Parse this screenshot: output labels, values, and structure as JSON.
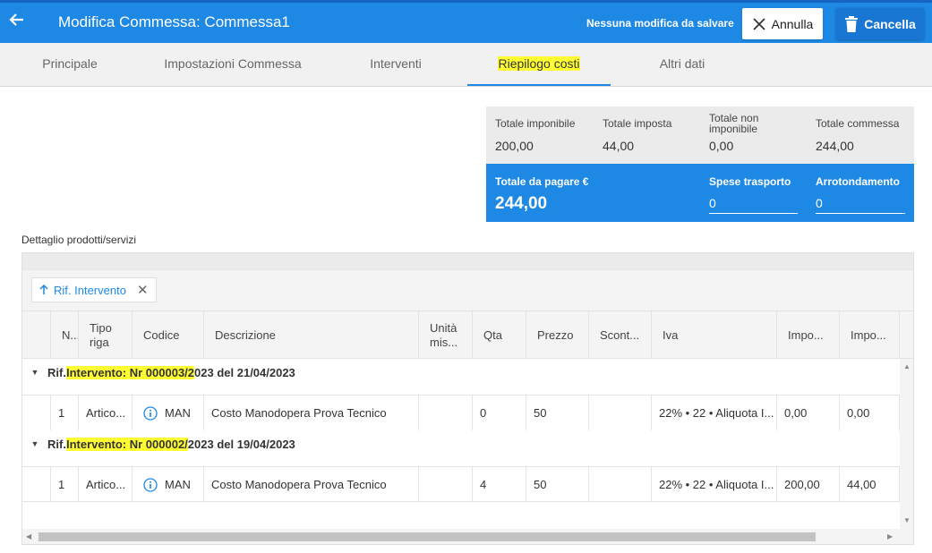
{
  "header": {
    "title": "Modifica Commessa: Commessa1",
    "status": "Nessuna modifica da salvare",
    "annulla_label": "Annulla",
    "cancella_label": "Cancella"
  },
  "tabs": [
    {
      "label": "Principale"
    },
    {
      "label": "Impostazioni Commessa"
    },
    {
      "label": "Interventi"
    },
    {
      "label": "Riepilogo costi"
    },
    {
      "label": "Altri dati"
    }
  ],
  "totals": {
    "imponibile_label": "Totale imponibile",
    "imponibile_value": "200,00",
    "imposta_label": "Totale imposta",
    "imposta_value": "44,00",
    "non_imponibile_label": "Totale non imponibile",
    "non_imponibile_value": "0,00",
    "commessa_label": "Totale commessa",
    "commessa_value": "244,00",
    "da_pagare_label": "Totale da pagare €",
    "da_pagare_value": "244,00",
    "spese_label": "Spese trasporto",
    "spese_value": "0",
    "arrotondamento_label": "Arrotondamento",
    "arrotondamento_value": "0"
  },
  "section_label": "Dettaglio prodotti/servizi",
  "grid": {
    "group_chip": "Rif. Intervento",
    "columns": [
      "N...",
      "Tipo riga",
      "Codice",
      "Descrizione",
      "Unità mis...",
      "Qta",
      "Prezzo",
      "Scont...",
      "Iva",
      "Impo...",
      "Impo..."
    ],
    "groups": [
      {
        "prefix": "Rif. ",
        "highlight": "Intervento: Nr 000003/2",
        "suffix": "023 del 21/04/2023",
        "row": {
          "n": "1",
          "tipo": "Artico...",
          "codice": "MAN",
          "descrizione": "Costo Manodopera Prova Tecnico",
          "unita": "",
          "qta": "0",
          "prezzo": "50",
          "sconto": "",
          "iva": "22% • 22 • Aliquota I...",
          "imp1": "0,00",
          "imp2": "0,00"
        }
      },
      {
        "prefix": "Rif. ",
        "highlight": "Intervento: Nr 000002/",
        "suffix": "2023 del 19/04/2023",
        "row": {
          "n": "1",
          "tipo": "Artico...",
          "codice": "MAN",
          "descrizione": "Costo Manodopera Prova Tecnico",
          "unita": "",
          "qta": "4",
          "prezzo": "50",
          "sconto": "",
          "iva": "22% • 22 • Aliquota I...",
          "imp1": "200,00",
          "imp2": "44,00"
        }
      }
    ]
  },
  "colors": {
    "primary": "#1e88e5",
    "highlight": "#ffff33"
  }
}
